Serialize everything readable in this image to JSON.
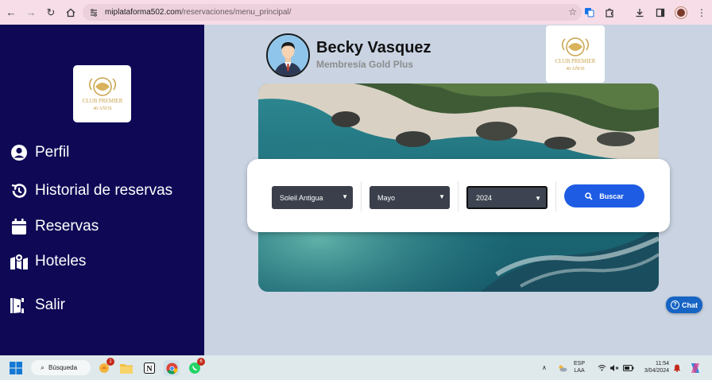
{
  "browser": {
    "url_domain": "miplataforma502.com",
    "url_path": "/reservaciones/menu_principal/"
  },
  "sidebar": {
    "items": [
      {
        "label": "Perfil",
        "icon": "user-circle-icon"
      },
      {
        "label": "Historial de reservas",
        "icon": "history-icon"
      },
      {
        "label": "Reservas",
        "icon": "calendar-icon"
      },
      {
        "label": "Hoteles",
        "icon": "map-icon"
      },
      {
        "label": "Salir",
        "icon": "door-exit-icon"
      }
    ]
  },
  "header": {
    "user_name": "Becky Vasquez",
    "membership": "Membresía Gold Plus"
  },
  "logo": {
    "line1": "CLUB PREMIER",
    "line2": "40 AÑOS"
  },
  "search": {
    "hotel_value": "Soleil Antigua",
    "month_value": "Mayo",
    "year_value": "2024",
    "button_label": "Buscar"
  },
  "chat": {
    "label": "Chat"
  },
  "taskbar": {
    "search_label": "Búsqueda",
    "lang_line1": "ESP",
    "lang_line2": "LAA",
    "time": "11:54",
    "date": "3/04/2024",
    "badge_widgets": "1",
    "badge_whatsapp": "6"
  },
  "colors": {
    "sidebar": "#0e0855",
    "main_bg": "#c9d3e2",
    "accent_button": "#1e5ce4",
    "chat_button": "#1664c4",
    "browser_chrome": "#f6dde8"
  }
}
